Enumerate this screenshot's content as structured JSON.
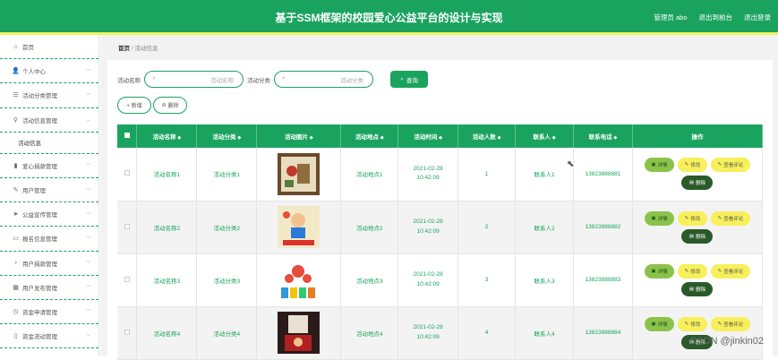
{
  "header": {
    "title": "基于SSM框架的校园爱心公益平台的设计与实现",
    "admin_label": "管理员 abo",
    "back_label": "退出到前台",
    "logout_label": "退出登录"
  },
  "sidebar": {
    "items": [
      {
        "label": "首页",
        "icon": "home-icon",
        "glyph": "⌂",
        "chevron": false
      },
      {
        "label": "个人中心",
        "icon": "user-icon",
        "glyph": "👤",
        "chevron": true
      },
      {
        "label": "活动分类管理",
        "icon": "list-icon",
        "glyph": "☰",
        "chevron": true
      },
      {
        "label": "活动信息管理",
        "icon": "pin-icon",
        "glyph": "⚲",
        "chevron": true,
        "expanded": true
      },
      {
        "label": "爱心捐款管理",
        "icon": "chart-icon",
        "glyph": "▮",
        "chevron": true
      },
      {
        "label": "用户管理",
        "icon": "edit-icon",
        "glyph": "✎",
        "chevron": true
      },
      {
        "label": "公益宣传管理",
        "icon": "send-icon",
        "glyph": "➤",
        "chevron": true
      },
      {
        "label": "报名信息管理",
        "icon": "message-icon",
        "glyph": "▭",
        "chevron": true
      },
      {
        "label": "用户捐款管理",
        "icon": "mic-icon",
        "glyph": "♪",
        "chevron": true
      },
      {
        "label": "用户发布管理",
        "icon": "grid-icon",
        "glyph": "▦",
        "chevron": true
      },
      {
        "label": "资金申请管理",
        "icon": "clock-icon",
        "glyph": "◷",
        "chevron": true
      },
      {
        "label": "资金流动管理",
        "icon": "phone-icon",
        "glyph": "▯",
        "chevron": true
      }
    ],
    "sub_item": "活动信息"
  },
  "breadcrumb": {
    "home": "首页",
    "sep": "/",
    "current": "活动信息"
  },
  "search": {
    "name_label": "活动名称",
    "name_placeholder": "活动名称",
    "category_label": "活动分类",
    "category_placeholder": "活动分类",
    "query_label": "查询"
  },
  "actions": {
    "add_label": "+ 新增",
    "delete_label": "删除"
  },
  "table": {
    "columns": [
      "活动名称",
      "活动分类",
      "活动图片",
      "活动地点",
      "活动时间",
      "活动人数",
      "联系人",
      "联系电话",
      "操作"
    ],
    "rows": [
      {
        "name": "活动名称1",
        "category": "活动分类1",
        "location": "活动地点1",
        "time": "2021-02-28 10:42:09",
        "people": "1",
        "contact": "联系人1",
        "phone": "13823888881",
        "image": "painting"
      },
      {
        "name": "活动名称2",
        "category": "活动分类2",
        "location": "活动地点2",
        "time": "2021-02-28 10:42:09",
        "people": "2",
        "contact": "联系人2",
        "phone": "13823888882",
        "image": "cartoon"
      },
      {
        "name": "活动名称3",
        "category": "活动分类3",
        "location": "活动地点3",
        "time": "2021-02-28 10:42:09",
        "people": "3",
        "contact": "联系人3",
        "phone": "13823888883",
        "image": "hearts"
      },
      {
        "name": "活动名称4",
        "category": "活动分类4",
        "location": "活动地点4",
        "time": "2021-02-28 10:42:09",
        "people": "4",
        "contact": "联系人4",
        "phone": "13823888884",
        "image": "poster"
      }
    ],
    "op_detail": "详情",
    "op_edit": "修改",
    "op_comment": "查看评论",
    "op_delete": "删除"
  },
  "watermark": "CSDN @jinkin02",
  "colors": {
    "primary": "#1aa35f",
    "accent_yellow": "#f7f05a",
    "stripe": "#f2f25a"
  }
}
